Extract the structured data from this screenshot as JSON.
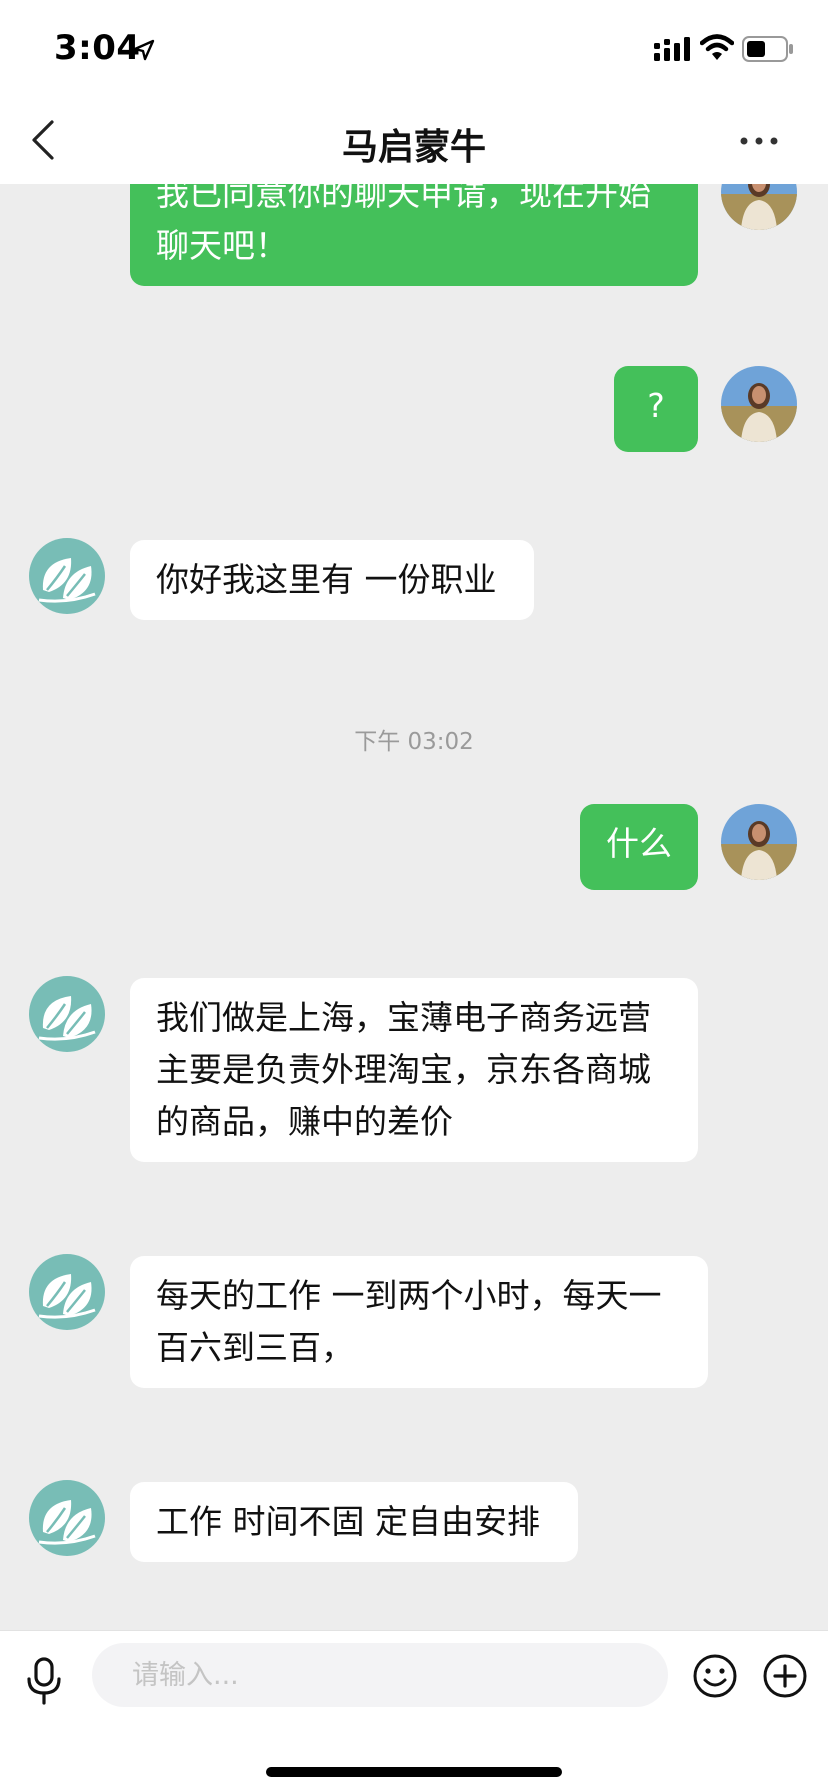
{
  "status_bar": {
    "time": "3:04",
    "icons": [
      "location-arrow-icon",
      "signal-icon",
      "wifi-icon",
      "battery-icon"
    ]
  },
  "nav": {
    "title": "马启蒙牛",
    "back_icon": "chevron-left-icon",
    "more_icon": "more-dots-icon"
  },
  "messages": [
    {
      "from": "me",
      "text": "我已同意你的聊天申请，现在开始聊天吧！"
    },
    {
      "from": "me",
      "text": "?"
    },
    {
      "from": "other",
      "text": "你好我这里有 一份职业"
    },
    {
      "from": "me",
      "text": "什么"
    },
    {
      "from": "other",
      "text": "我们做是上海，宝薄电子商务远营主要是负责外理淘宝，京东各商城的商品，赚中的差价"
    },
    {
      "from": "other",
      "text": "每天的工作 一到两个小时，每天一百六到三百，"
    },
    {
      "from": "other",
      "text": "工作 时间不固 定自由安排"
    }
  ],
  "timestamp": "下午 03:02",
  "input": {
    "placeholder": "请输入...",
    "value": ""
  },
  "colors": {
    "sent_bubble": "#44c05a",
    "received_bubble": "#ffffff",
    "background": "#ededed",
    "avatar_other": "#78bdb6"
  }
}
